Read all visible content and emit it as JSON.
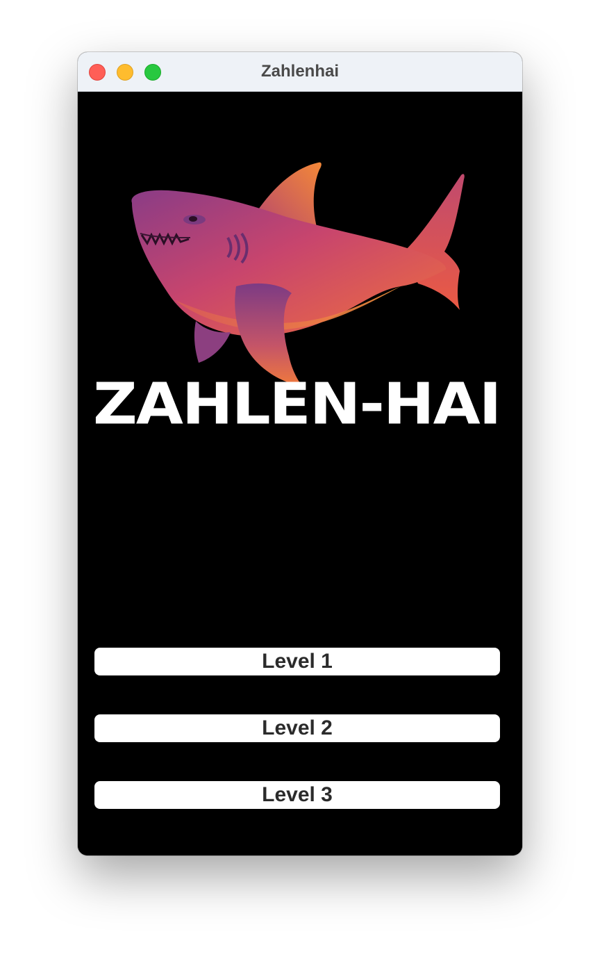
{
  "window": {
    "title": "Zahlenhai"
  },
  "logo": {
    "text": "ZAHLEN-HAI",
    "image": "shark-logo"
  },
  "levels": [
    {
      "label": "Level 1"
    },
    {
      "label": "Level 2"
    },
    {
      "label": "Level 3"
    }
  ],
  "colors": {
    "background": "#000000",
    "titlebar": "#eef2f7",
    "button": "#ffffff",
    "button_text": "#2b2b2b",
    "shark_orange": "#f07a3c",
    "shark_magenta": "#d2406a",
    "shark_purple": "#7e3a82"
  }
}
